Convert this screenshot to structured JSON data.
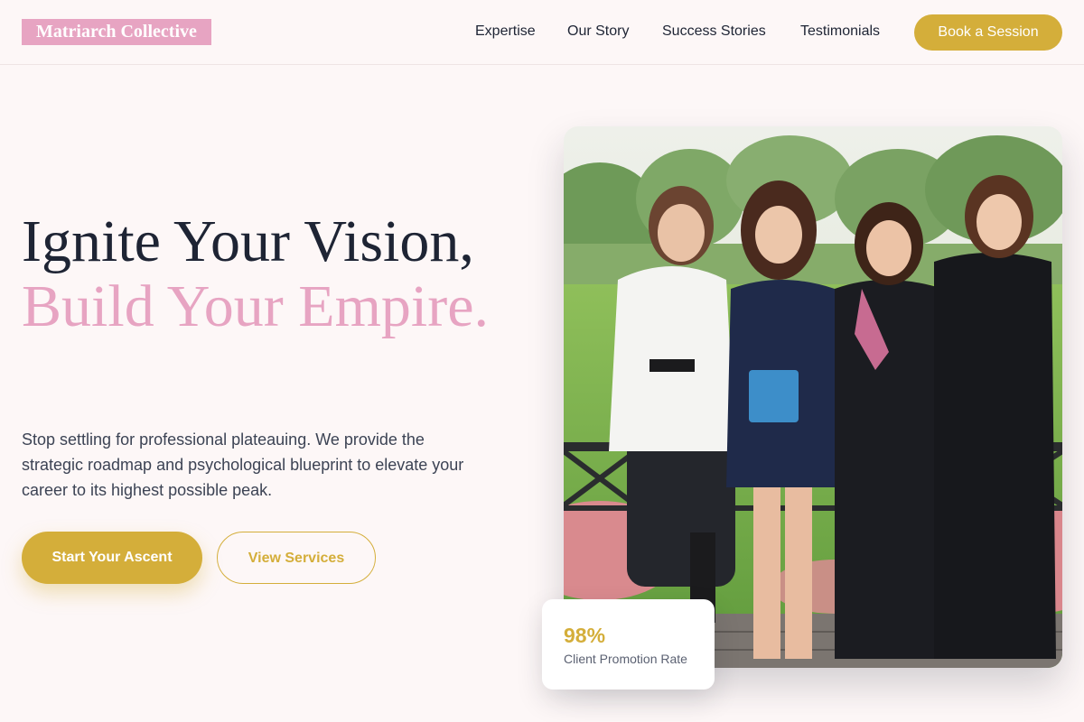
{
  "brand": {
    "name": "Matriarch Collective"
  },
  "nav": {
    "items": [
      {
        "label": "Expertise"
      },
      {
        "label": "Our Story"
      },
      {
        "label": "Success Stories"
      },
      {
        "label": "Testimonials"
      }
    ],
    "cta_label": "Book a Session"
  },
  "hero": {
    "headline_line1": "Ignite Your Vision,",
    "headline_line2": "Build Your Empire.",
    "subtext": "Stop settling for professional plateauing. We provide the strategic roadmap and psychological blueprint to elevate your career to its highest possible peak.",
    "primary_button": "Start Your Ascent",
    "secondary_button": "View Services"
  },
  "stat": {
    "value": "98%",
    "label": "Client Promotion Rate"
  },
  "colors": {
    "background": "#fdf7f7",
    "accent_gold": "#d4ae3a",
    "accent_pink": "#e7a4c2",
    "text_dark": "#1e2434"
  }
}
